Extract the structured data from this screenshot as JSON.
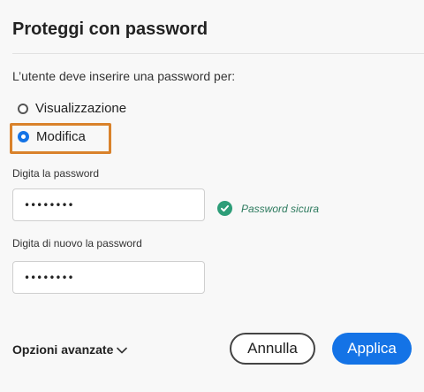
{
  "dialog": {
    "title": "Proteggi con password",
    "prompt": "L’utente deve inserire una password per:",
    "options": [
      {
        "label": "Visualizzazione",
        "checked": false
      },
      {
        "label": "Modifica",
        "checked": true
      }
    ],
    "password_label": "Digita la password",
    "password_value": "••••••••",
    "strength_text": "Password sicura",
    "confirm_label": "Digita di nuovo la password",
    "confirm_value": "••••••••",
    "advanced_label": "Opzioni avanzate",
    "cancel_label": "Annulla",
    "apply_label": "Applica"
  },
  "icons": {
    "strength": "check-circle-icon",
    "advanced": "chevron-down-icon"
  },
  "colors": {
    "accent": "#1473e6",
    "success": "#2d9d78",
    "highlight": "#d9822b"
  }
}
